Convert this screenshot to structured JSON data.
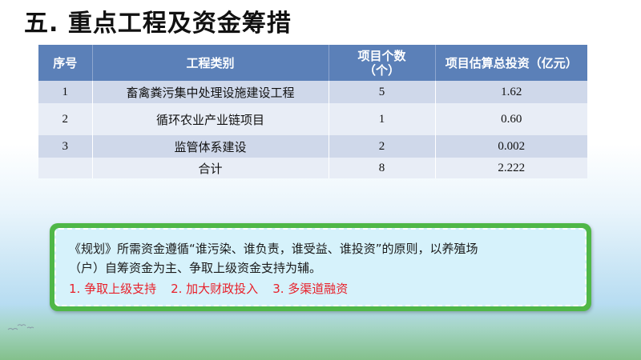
{
  "title": "五. 重点工程及资金筹措",
  "table": {
    "headers": {
      "seq": "序号",
      "category": "工程类别",
      "count_line1": "项目个数",
      "count_line2": "（个）",
      "investment": "项目估算总投资（亿元）"
    },
    "rows": [
      {
        "seq": "1",
        "category": "畜禽粪污集中处理设施建设工程",
        "count": "5",
        "investment": "1.62"
      },
      {
        "seq": "2",
        "category": "循环农业产业链项目",
        "count": "1",
        "investment": "0.60"
      },
      {
        "seq": "3",
        "category": "监管体系建设",
        "count": "2",
        "investment": "0.002"
      }
    ],
    "total": {
      "label": "合计",
      "count": "8",
      "investment": "2.222"
    }
  },
  "note": {
    "line1": "《规划》所需资金遵循“谁污染、谁负责，谁受益、谁投资”的原则，以养殖场",
    "line2": "（户）自筹资金为主、争取上级资金支持为辅。",
    "measures": [
      "1. 争取上级支持",
      "2. 加大财政投入",
      "3. 多渠道融资"
    ]
  },
  "colors": {
    "header_bg": "#5b80b8",
    "row_dark": "#cfd8ea",
    "row_light": "#e8edf6",
    "note_border": "#4fb747",
    "note_bg": "#d6f2fb",
    "measure_text": "#e8202a"
  }
}
